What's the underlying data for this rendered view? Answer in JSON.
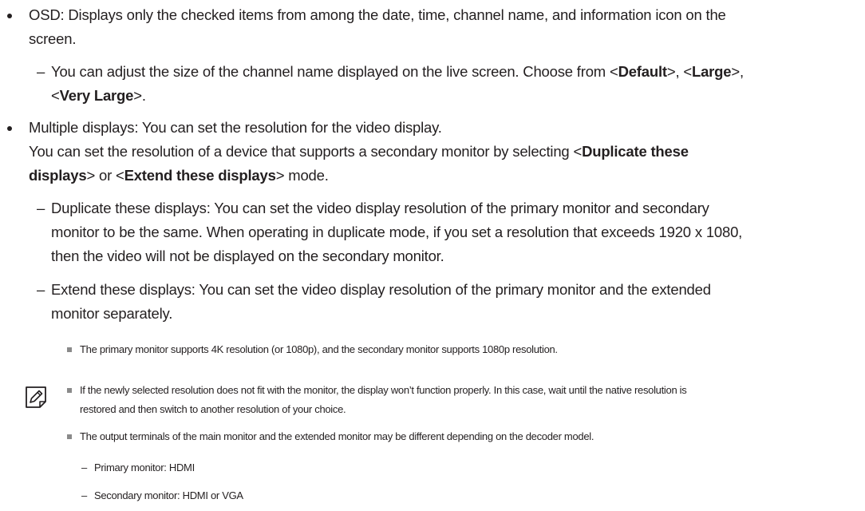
{
  "osd": {
    "label": "OSD: Displays only the checked items from among the date, time, channel name, and information icon on the",
    "label_cont": "screen.",
    "sub": {
      "text_a": "You can adjust the size of the channel name displayed on the live screen. Choose from <",
      "default_label": "Default",
      "sep1": ">, <",
      "large_label": "Large",
      "sep2": ">,",
      "line2_lt": "<",
      "very_large_label": "Very Large",
      "line2_end": ">."
    }
  },
  "multi": {
    "line1": "Multiple displays: You can set the resolution for the video display.",
    "line2_a": "You can set the resolution of a device that supports a secondary monitor by selecting <",
    "duplicate_label_a": "Duplicate these",
    "duplicate_label_b": "displays",
    "line3_mid": "> or <",
    "extend_label": "Extend these displays",
    "line3_end": "> mode.",
    "dup_sub_1": "Duplicate these displays: You can set the video display resolution of the primary monitor and secondary",
    "dup_sub_2": "monitor to be the same. When operating in duplicate mode, if you set a resolution that exceeds 1920 x 1080,",
    "dup_sub_3": "then the video will not be displayed on the secondary monitor.",
    "ext_sub_1": "Extend these displays: You can set the video display resolution of the primary monitor and the extended",
    "ext_sub_2": "monitor separately.",
    "ext_note": "The primary monitor supports 4K resolution (or 1080p), and the secondary monitor supports 1080p resolution."
  },
  "note": {
    "icon": "note-pencil-icon",
    "item1_a": "If the newly selected resolution does not fit with the monitor, the display won’t function properly. In this case, wait until the native resolution is",
    "item1_b": "restored and then switch to another resolution of your choice.",
    "item2": "The output terminals of the main monitor and the extended monitor may be different depending on the decoder model.",
    "sub1": "Primary monitor: HDMI",
    "sub2": "Secondary monitor: HDMI or VGA"
  },
  "dash_glyph": "–"
}
